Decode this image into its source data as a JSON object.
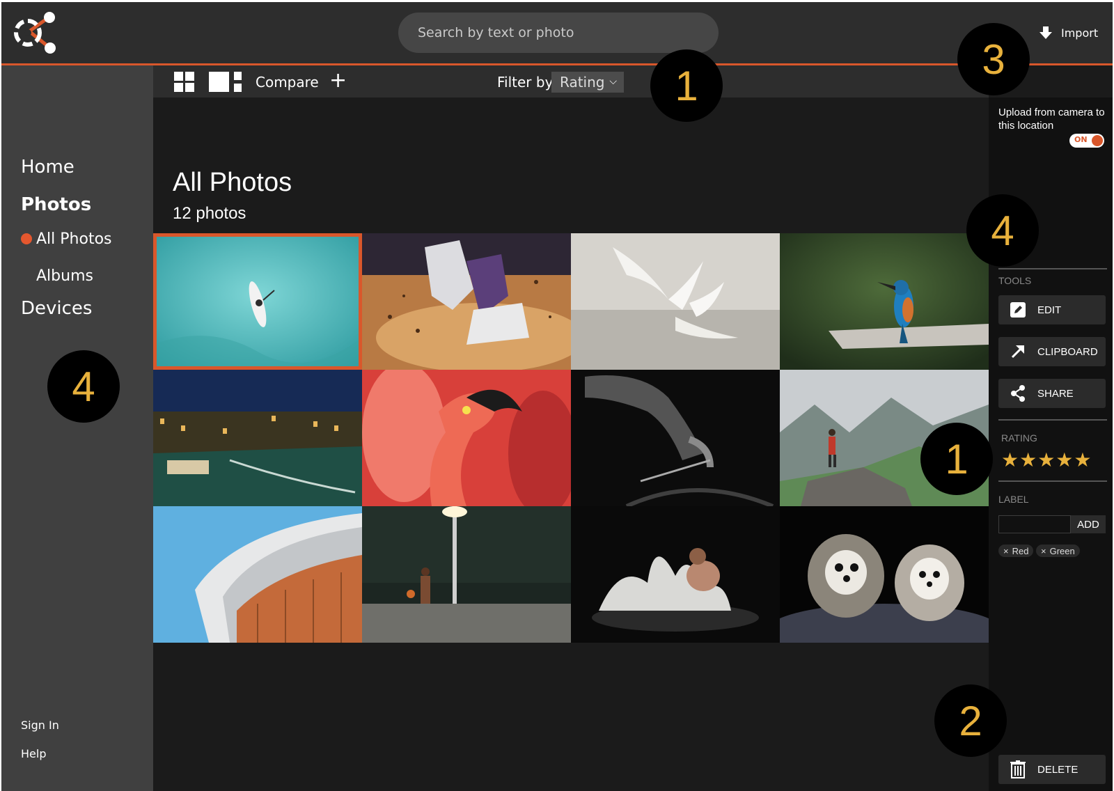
{
  "header": {
    "search_placeholder": "Search by text or photo",
    "import_label": "Import"
  },
  "toolbar": {
    "compare_label": "Compare",
    "add_symbol": "+",
    "filter_label": "Filter by",
    "filter_value": "Rating"
  },
  "sidebar": {
    "home": "Home",
    "photos": "Photos",
    "all_photos": "All Photos",
    "albums": "Albums",
    "devices": "Devices",
    "sign_in": "Sign In",
    "help": "Help"
  },
  "main": {
    "title": "All Photos",
    "count": "12 photos",
    "photos": [
      {
        "subject": "paddleboard-aerial",
        "selected": true
      },
      {
        "subject": "running-shoes-dust",
        "selected": false
      },
      {
        "subject": "egrets-fighting",
        "selected": false
      },
      {
        "subject": "kingfisher-on-branch",
        "selected": false
      },
      {
        "subject": "venice-canal-night",
        "selected": false
      },
      {
        "subject": "flamingo-closeup",
        "selected": false
      },
      {
        "subject": "cyclist-black-white",
        "selected": false
      },
      {
        "subject": "hiker-mountain-peak",
        "selected": false
      },
      {
        "subject": "curved-building-roof",
        "selected": false
      },
      {
        "subject": "basketball-player-night",
        "selected": false
      },
      {
        "subject": "powder-explosion-athlete",
        "selected": false
      },
      {
        "subject": "two-shih-tzu-dogs",
        "selected": false
      }
    ]
  },
  "right_panel": {
    "upload_text": "Upload from camera to this location",
    "toggle_label": "ON",
    "tools_label": "TOOLS",
    "edit": "EDIT",
    "clipboard": "CLIPBOARD",
    "share": "SHARE",
    "rating_label": "RATING",
    "rating_stars": "★★★★★",
    "rating_value": 5,
    "label_label": "LABEL",
    "add_label": "ADD",
    "chips": [
      "Red",
      "Green"
    ],
    "chip_remove_symbol": "×",
    "delete": "DELETE"
  },
  "annotations": [
    "1",
    "3",
    "4",
    "4",
    "1",
    "2"
  ],
  "colors": {
    "accent": "#d9572b",
    "star": "#e8b13c",
    "background": "#1b1b1b",
    "header": "#2d2d2d",
    "sidebar": "#404040"
  }
}
